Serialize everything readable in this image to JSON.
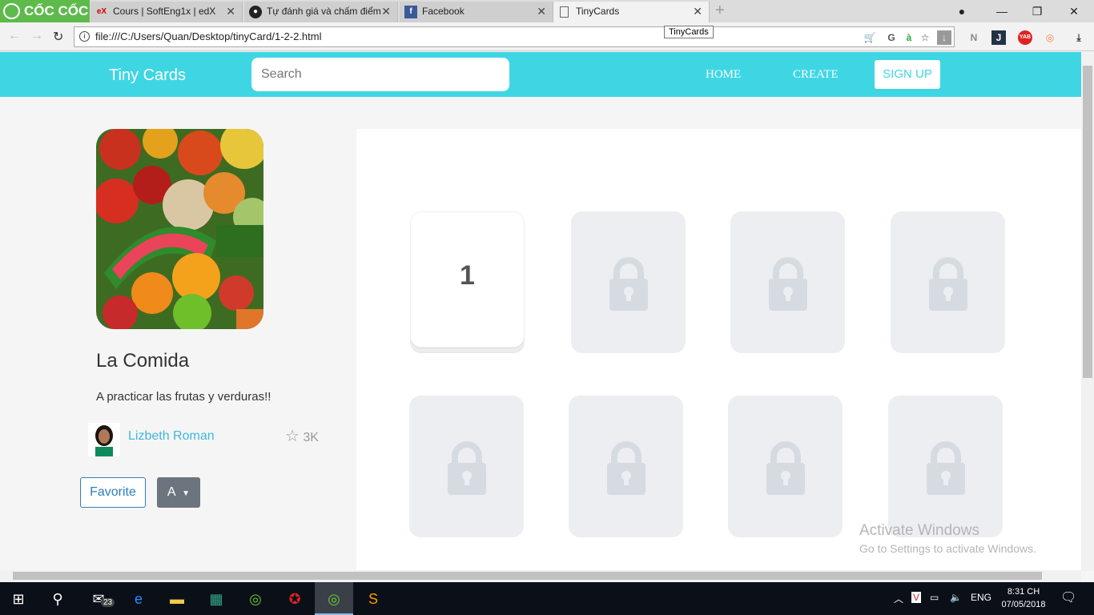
{
  "browser": {
    "brand": "CỐC CỐC",
    "tabs": [
      {
        "title": "Cours | SoftEng1x | edX",
        "icon": "edx-icon"
      },
      {
        "title": "Tự đánh giá và chấm điểm",
        "icon": "github-icon"
      },
      {
        "title": "Facebook",
        "icon": "facebook-icon"
      },
      {
        "title": "TinyCards",
        "icon": "page-icon",
        "active": true
      }
    ],
    "url": "file:///C:/Users/Quan/Desktop/tinyCard/1-2-2.html",
    "tooltip": "TinyCards"
  },
  "navbar": {
    "title": "Tiny Cards",
    "search_placeholder": "Search",
    "home": "HOME",
    "create": "CREATE",
    "signup": "SIGN UP"
  },
  "deck": {
    "title": "La Comida",
    "description": "A practicar las frutas y verduras!!",
    "author": "Lizbeth Roman",
    "stars": "3K",
    "favorite": "Favorite",
    "level": "A"
  },
  "cards": [
    {
      "label": "1",
      "locked": false
    },
    {
      "locked": true
    },
    {
      "locked": true
    },
    {
      "locked": true
    },
    {
      "locked": true
    },
    {
      "locked": true
    },
    {
      "locked": true
    },
    {
      "locked": true
    }
  ],
  "watermark": {
    "line1": "Activate Windows",
    "line2": "Go to Settings to activate Windows."
  },
  "taskbar": {
    "mail_badge": "23",
    "lang": "ENG",
    "time": "8:31 CH",
    "date": "07/05/2018"
  }
}
